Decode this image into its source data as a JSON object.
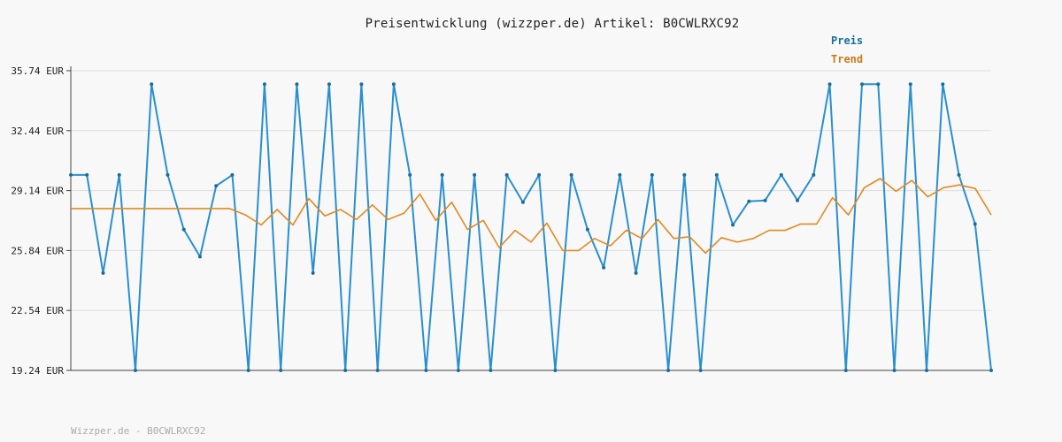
{
  "chart_data": {
    "type": "line",
    "title": "Preisentwicklung (wizzper.de) Artikel: B0CWLRXC92",
    "ylim": [
      19.24,
      35.74
    ],
    "yticks": [
      "35.74 EUR",
      "32.44 EUR",
      "29.14 EUR",
      "25.84 EUR",
      "22.54 EUR",
      "19.24 EUR"
    ],
    "ytick_values": [
      35.74,
      32.44,
      29.14,
      25.84,
      22.54,
      19.24
    ],
    "grid": true,
    "legend_position": "top-right",
    "series": [
      {
        "name": "Preis",
        "color": "#2a8fd0",
        "values": [
          30.0,
          30.0,
          24.6,
          30.0,
          19.24,
          35.0,
          30.0,
          27.0,
          25.5,
          29.4,
          30.0,
          19.24,
          35.0,
          19.24,
          35.0,
          24.6,
          35.0,
          19.24,
          35.0,
          19.24,
          35.0,
          30.0,
          19.24,
          30.0,
          19.24,
          30.0,
          19.24,
          30.0,
          28.5,
          30.0,
          19.24,
          30.0,
          27.0,
          24.9,
          30.0,
          24.6,
          30.0,
          19.24,
          30.0,
          19.24,
          30.0,
          27.25,
          28.55,
          28.6,
          30.0,
          28.6,
          30.0,
          35.0,
          19.24,
          35.0,
          35.0,
          19.24,
          35.0,
          19.24,
          35.0,
          30.0,
          27.3,
          19.24
        ]
      },
      {
        "name": "Trend",
        "color": "#e08a20",
        "values": [
          28.15,
          28.15,
          28.15,
          28.15,
          28.15,
          28.15,
          28.15,
          28.15,
          28.15,
          28.15,
          28.15,
          27.8,
          27.25,
          28.1,
          27.25,
          28.7,
          27.75,
          28.1,
          27.55,
          28.35,
          27.55,
          27.9,
          28.95,
          27.5,
          28.5,
          27.0,
          27.5,
          26.0,
          26.95,
          26.3,
          27.35,
          25.84,
          25.84,
          26.5,
          26.1,
          26.95,
          26.5,
          27.55,
          26.5,
          26.6,
          25.7,
          26.55,
          26.3,
          26.5,
          26.95,
          26.95,
          27.3,
          27.3,
          28.75,
          27.8,
          29.3,
          29.8,
          29.1,
          29.7,
          28.8,
          29.3,
          29.45,
          29.25,
          27.8
        ]
      }
    ]
  },
  "labels": {
    "title": "Preisentwicklung (wizzper.de) Artikel: B0CWLRXC92",
    "legend_preis": "Preis",
    "legend_trend": "Trend",
    "footer": "Wizzper.de - B0CWLRXC92"
  }
}
